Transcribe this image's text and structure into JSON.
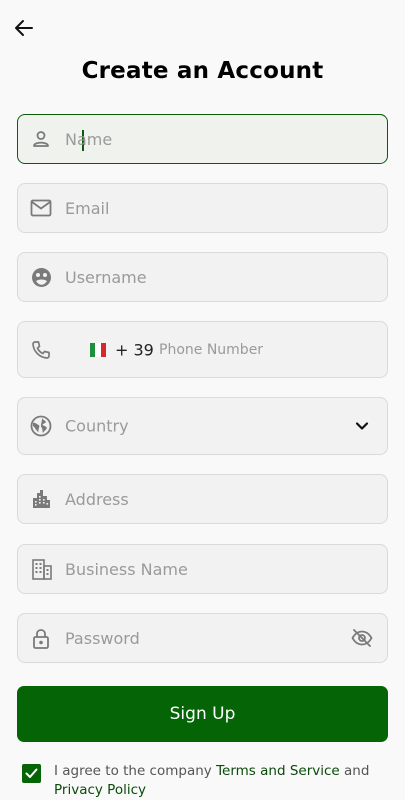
{
  "header": {
    "back_icon": "arrow-left-icon",
    "title": "Create an Account"
  },
  "form": {
    "name": {
      "placeholder": "Name",
      "value": "",
      "icon": "person-icon"
    },
    "email": {
      "placeholder": "Email",
      "value": "",
      "icon": "mail-icon"
    },
    "username": {
      "placeholder": "Username",
      "value": "",
      "icon": "face-icon"
    },
    "phone": {
      "placeholder": "Phone Number",
      "value": "",
      "icon": "phone-icon",
      "country_flag": "italy-flag-icon",
      "dial_code": "+ 39"
    },
    "country": {
      "placeholder": "Country",
      "icon": "globe-icon",
      "dropdown_icon": "chevron-down-icon"
    },
    "address": {
      "placeholder": "Address",
      "value": "",
      "icon": "city-icon"
    },
    "business_name": {
      "placeholder": "Business Name",
      "value": "",
      "icon": "building-icon"
    },
    "password": {
      "placeholder": "Password",
      "value": "",
      "icon": "lock-icon",
      "visibility_icon": "eye-off-icon"
    }
  },
  "signup_label": "Sign Up",
  "terms": {
    "checked": true,
    "prefix": "I agree to the company ",
    "terms_link": "Terms and Service",
    "middle": " and ",
    "privacy_link": "Privacy Policy"
  },
  "colors": {
    "primary": "#056405",
    "focus_border": "#0a5c0a",
    "field_background": "#f2f2f2",
    "placeholder": "#9a9a9a",
    "icon": "#7a7a7a"
  }
}
